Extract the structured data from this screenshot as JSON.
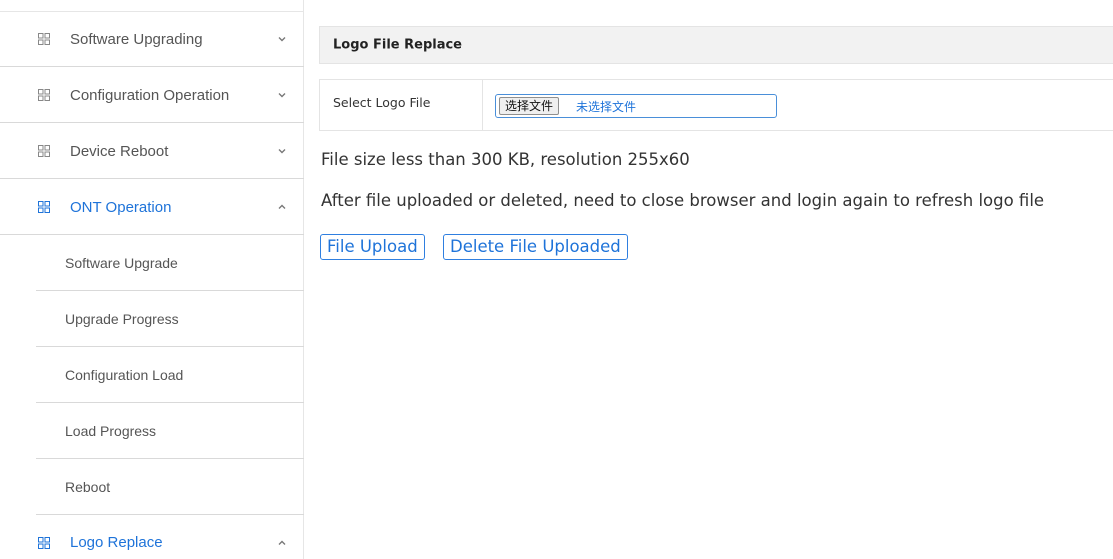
{
  "colors": {
    "accent": "#1e73d9",
    "header_bg": "#f2f2f2",
    "divider": "#d9d9d9",
    "text": "#555555"
  },
  "sidebar": {
    "items": [
      {
        "label": "Software Upgrading",
        "expanded": false,
        "active": false,
        "icon": "grid-icon"
      },
      {
        "label": "Configuration Operation",
        "expanded": false,
        "active": false,
        "icon": "grid-icon"
      },
      {
        "label": "Device Reboot",
        "expanded": false,
        "active": false,
        "icon": "grid-icon"
      },
      {
        "label": "ONT Operation",
        "expanded": true,
        "active": true,
        "icon": "grid-icon",
        "children": [
          "Software Upgrade",
          "Upgrade Progress",
          "Configuration Load",
          "Load Progress",
          "Reboot"
        ]
      },
      {
        "label": "Logo Replace",
        "expanded": true,
        "active": true,
        "icon": "grid-icon"
      }
    ]
  },
  "main": {
    "panel_title": "Logo File Replace",
    "select_label": "Select Logo File",
    "file_button_label": "选择文件",
    "file_status": "未选择文件",
    "note_size": "File size less than 300 KB, resolution 255x60",
    "note_refresh": "After file uploaded or deleted, need to close browser and login again to refresh logo file",
    "upload_button": "File Upload",
    "delete_button": "Delete File Uploaded"
  }
}
